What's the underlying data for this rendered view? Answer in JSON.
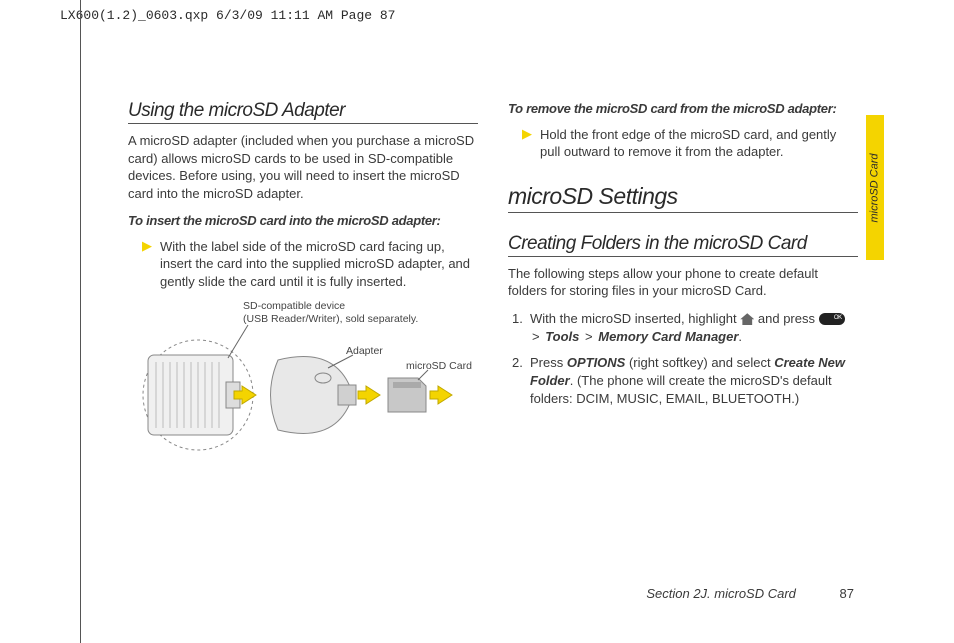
{
  "print_header": "LX600(1.2)_0603.qxp  6/3/09  11:11 AM  Page 87",
  "side_tab": "microSD Card",
  "left": {
    "h2": "Using the microSD Adapter",
    "p1": "A microSD adapter (included when you purchase a microSD card) allows microSD cards to be used in SD-compatible devices. Before using, you will need to insert the microSD card into the microSD adapter.",
    "sub1": "To insert the microSD card into the microSD adapter:",
    "b1": "With the label side of the microSD card facing up, insert the card into the supplied microSD adapter, and gently slide the card until it is fully inserted.",
    "diagram": {
      "l1a": "SD-compatible device",
      "l1b": "(USB Reader/Writer), sold separately.",
      "l2": "Adapter",
      "l3": "microSD Card"
    }
  },
  "right": {
    "sub1": "To remove the microSD card from the microSD adapter:",
    "b1": "Hold the front edge of the microSD card, and gently pull outward to remove it from the adapter.",
    "h1": "microSD Settings",
    "h2": "Creating Folders in the microSD Card",
    "p1": "The following steps allow your phone to create default folders for storing files in your microSD Card.",
    "step1_a": "With the microSD inserted, highlight ",
    "step1_b": " and press ",
    "step1_c": "Tools",
    "step1_d": "Memory Card Manager",
    "step2_a": "Press ",
    "step2_b": "OPTIONS",
    "step2_c": " (right softkey) and select ",
    "step2_d": "Create New Folder",
    "step2_e": ". (The phone will create the microSD's default folders: DCIM, MUSIC, EMAIL, BLUETOOTH.)"
  },
  "footer": {
    "section": "Section 2J. microSD Card",
    "page": "87"
  }
}
